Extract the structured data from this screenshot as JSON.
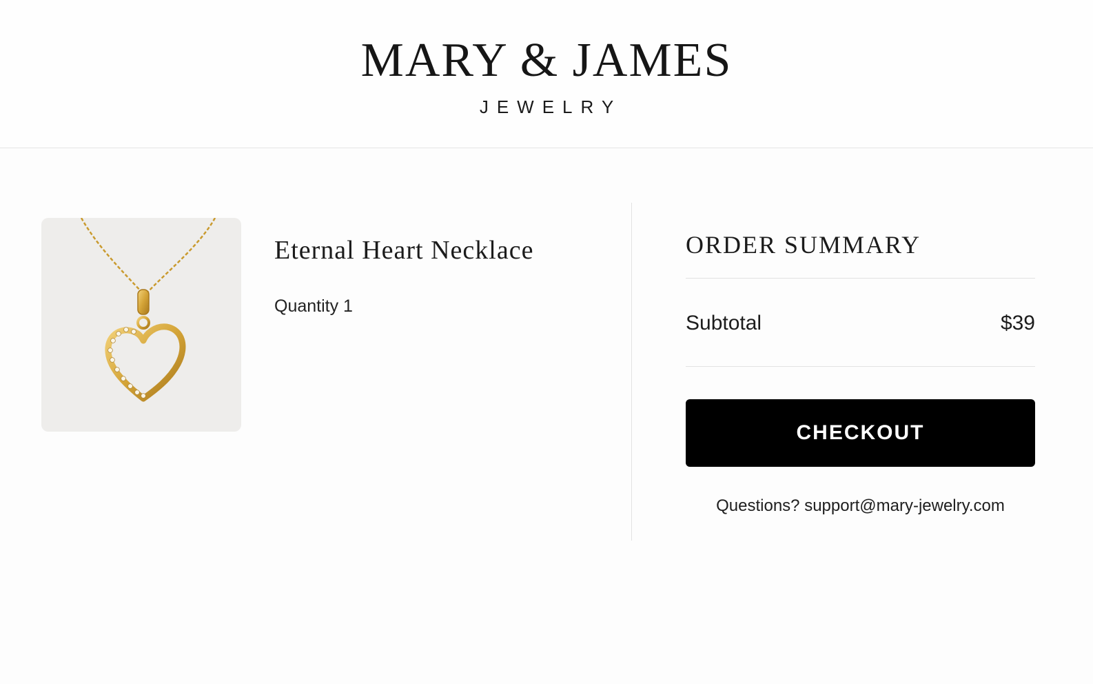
{
  "brand": {
    "name": "MARY & JAMES",
    "subtitle": "JEWELRY"
  },
  "cart": {
    "items": [
      {
        "name": "Eternal Heart Necklace",
        "quantity_text": "Quantity 1",
        "image_icon": "heart-pendant-necklace"
      }
    ]
  },
  "summary": {
    "title": "ORDER SUMMARY",
    "subtotal_label": "Subtotal",
    "subtotal_value": "$39",
    "checkout_label": "CHECKOUT",
    "support_prefix": "Questions?",
    "support_email": "support@mary-jewelry.com"
  },
  "colors": {
    "button_bg": "#000000",
    "button_text": "#ffffff",
    "gold": "#d4a437"
  }
}
